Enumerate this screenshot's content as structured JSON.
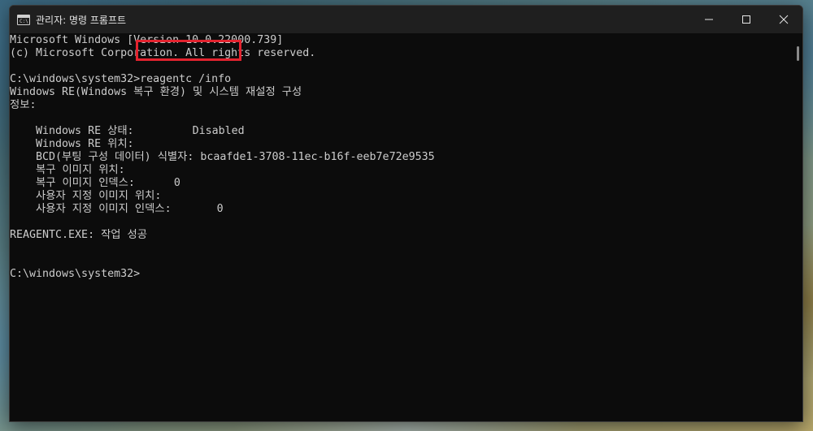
{
  "window": {
    "title": "관리자: 명령 프롬프트",
    "icon_glyph": "C:\\",
    "controls": {
      "minimize": "minimize-icon",
      "maximize": "maximize-icon",
      "close": "close-icon"
    }
  },
  "console": {
    "lines": [
      "Microsoft Windows [Version 10.0.22000.739]",
      "(c) Microsoft Corporation. All rights reserved.",
      "",
      "C:\\windows\\system32>reagentc /info",
      "Windows RE(Windows 복구 환경) 및 시스템 재설정 구성",
      "정보:",
      "",
      "    Windows RE 상태:         Disabled",
      "    Windows RE 위치:",
      "    BCD(부팅 구성 데이터) 식별자: bcaafde1-3708-11ec-b16f-eeb7e72e9535",
      "    복구 이미지 위치:",
      "    복구 이미지 인덱스:      0",
      "    사용자 지정 이미지 위치:",
      "    사용자 지정 이미지 인덱스:       0",
      "",
      "REAGENTC.EXE: 작업 성공",
      "",
      "",
      "C:\\windows\\system32>"
    ]
  },
  "colors": {
    "highlight": "#e3232f",
    "console_bg": "#0c0c0c",
    "console_text": "#cccccc"
  }
}
